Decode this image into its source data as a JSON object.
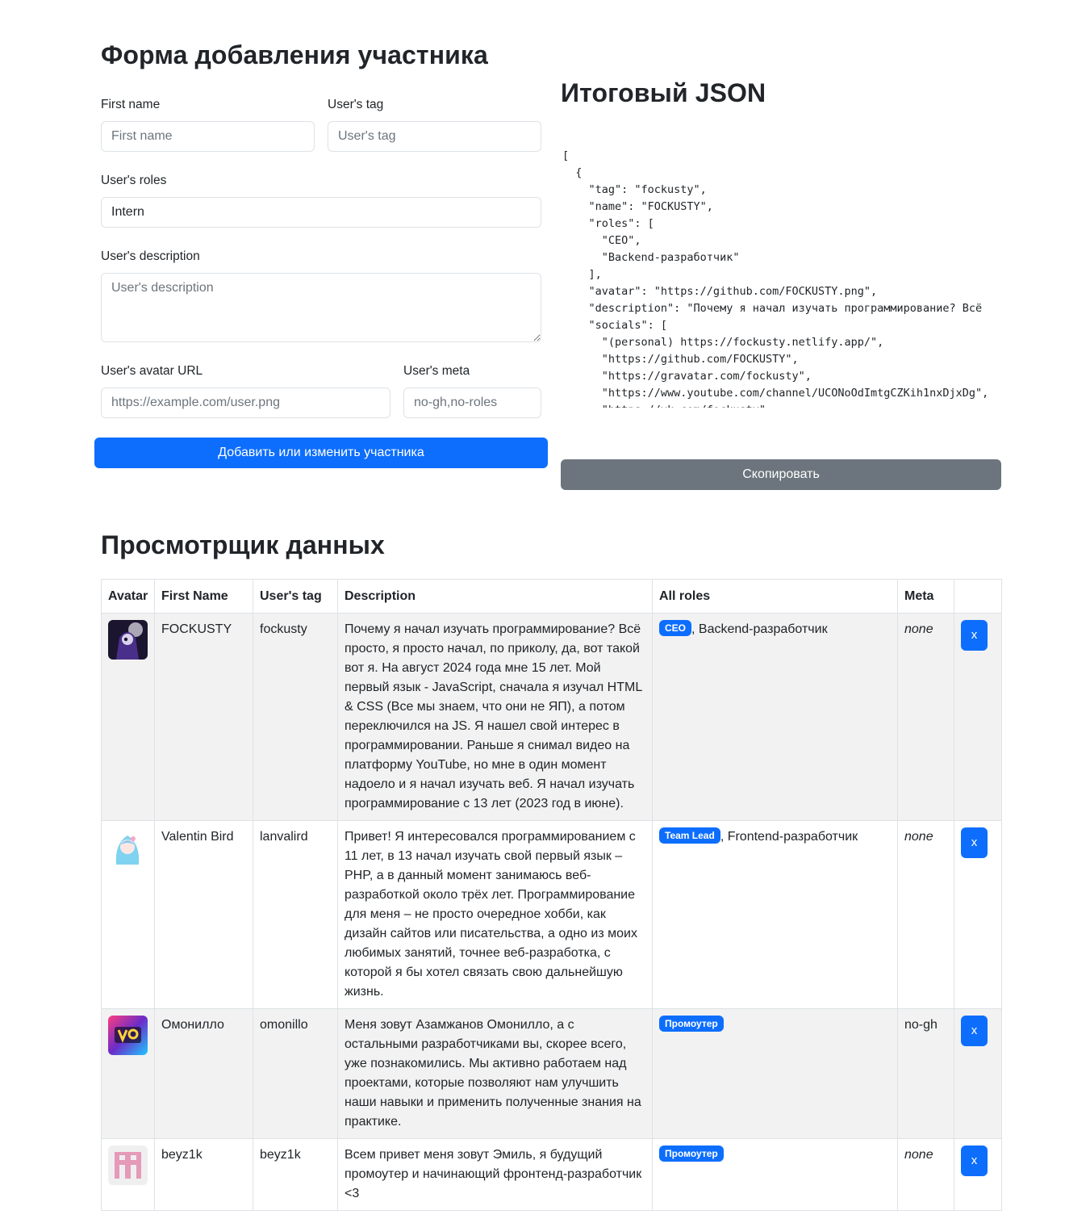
{
  "form": {
    "title": "Форма добавления участника",
    "first_name": {
      "label": "First name",
      "placeholder": "First name",
      "value": ""
    },
    "tag": {
      "label": "User's tag",
      "placeholder": "User's tag",
      "value": ""
    },
    "roles": {
      "label": "User's roles",
      "placeholder": "",
      "value": "Intern"
    },
    "description": {
      "label": "User's description",
      "placeholder": "User's description",
      "value": ""
    },
    "avatar_url": {
      "label": "User's avatar URL",
      "placeholder": "https://example.com/user.png",
      "value": ""
    },
    "meta": {
      "label": "User's meta",
      "placeholder": "no-gh,no-roles",
      "value": ""
    },
    "submit_label": "Добавить или изменить участника"
  },
  "json_panel": {
    "title": "Итоговый JSON",
    "content": "[\n  {\n    \"tag\": \"fockusty\",\n    \"name\": \"FOCKUSTY\",\n    \"roles\": [\n      \"CEO\",\n      \"Backend-разработчик\"\n    ],\n    \"avatar\": \"https://github.com/FOCKUSTY.png\",\n    \"description\": \"Почему я начал изучать программирование? Всё\n    \"socials\": [\n      \"(personal) https://fockusty.netlify.app/\",\n      \"https://github.com/FOCKUSTY\",\n      \"https://gravatar.com/fockusty\",\n      \"https://www.youtube.com/channel/UCONoOdImtgCZKih1nxDjxDg\",\n      \"https://vk.com/fockusty\"",
    "copy_label": "Скопировать"
  },
  "viewer": {
    "title": "Просмотрщик данных",
    "columns": [
      "Avatar",
      "First Name",
      "User's tag",
      "Description",
      "All roles",
      "Meta",
      ""
    ],
    "delete_label": "x",
    "rows": [
      {
        "name": "FOCKUSTY",
        "tag": "fockusty",
        "description": "Почему я начал изучать программирование? Всё просто, я просто начал, по приколу, да, вот такой вот я. На август 2024 года мне 15 лет. Мой первый язык - JavaScript, сначала я изучал HTML & CSS (Все мы знаем, что они не ЯП), а потом переключился на JS. Я нашел свой интерес в программировании. Раньше я снимал видео на платформу YouTube, но мне в один момент надоело и я начал изучать веб. Я начал изучать программирование с 13 лет (2023 год в июне).",
        "badge": "CEO",
        "roles_rest": ", Backend-разработчик",
        "meta": "none"
      },
      {
        "name": "Valentin Bird",
        "tag": "lanvalird",
        "description": "Привет! Я интересовался программированием с 11 лет, в 13 начал изучать свой первый язык – PHP, а в данный момент занимаюсь веб-разработкой около трёх лет. Программирование для меня – не просто очередное хобби, как дизайн сайтов или писательства, а одно из моих любимых занятий, точнее веб-разработка, с которой я бы хотел связать свою дальнейшую жизнь.",
        "badge": "Team Lead",
        "roles_rest": ", Frontend-разработчик",
        "meta": "none"
      },
      {
        "name": "Омонилло",
        "tag": "omonillo",
        "description": "Меня зовут Азамжанов Омонилло, а с остальными разработчиками вы, скорее всего, уже познакомились. Мы активно работаем над проектами, которые позволяют нам улучшить наши навыки и применить полученные знания на практике.",
        "badge": "Промоутер",
        "roles_rest": "",
        "meta": "no-gh"
      },
      {
        "name": "beyz1k",
        "tag": "beyz1k",
        "description": "Всем привет меня зовут Эмиль, я будущий промоутер и начинающий фронтенд-разработчик <3",
        "badge": "Промоутер",
        "roles_rest": "",
        "meta": "none"
      }
    ]
  }
}
